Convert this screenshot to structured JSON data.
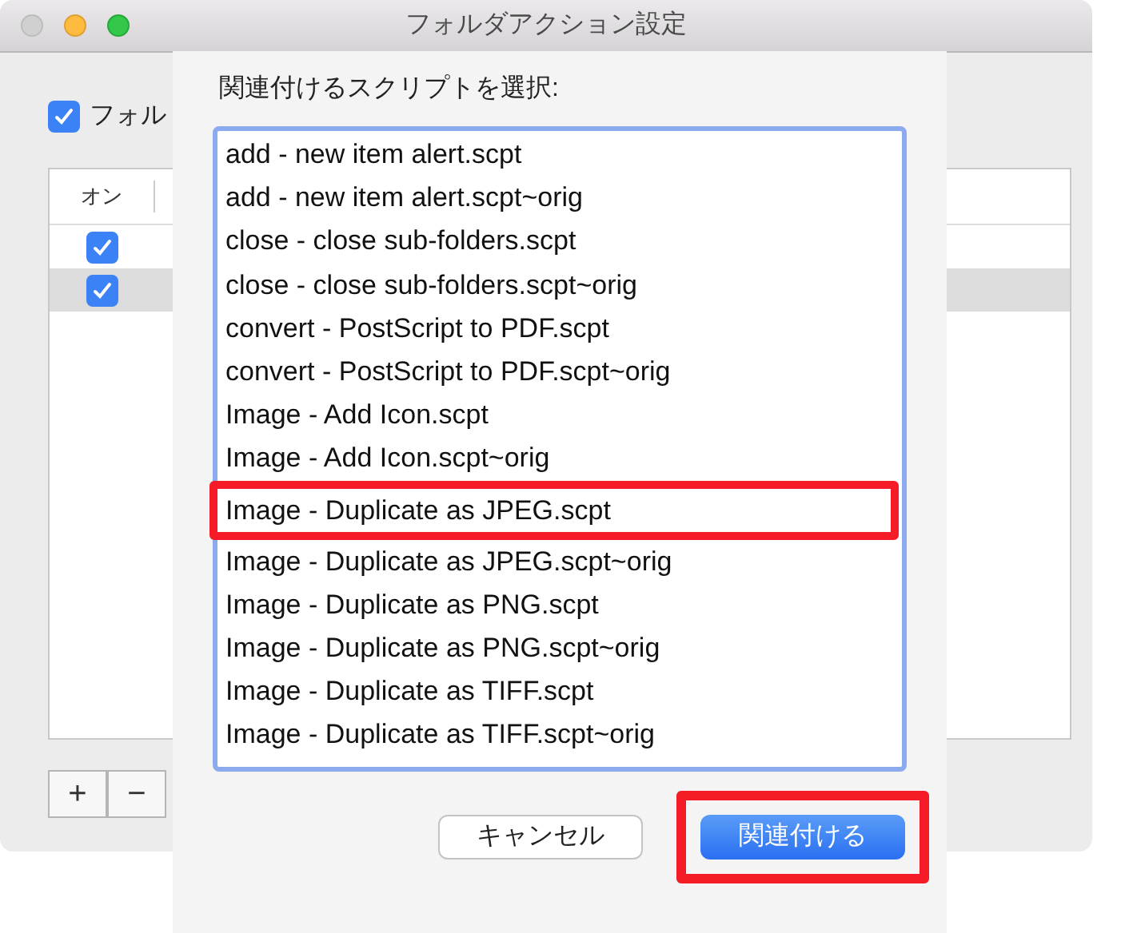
{
  "window": {
    "title": "フォルダアクション設定"
  },
  "background": {
    "enable_checkbox": {
      "label": "フォル",
      "checked": true
    },
    "table": {
      "columns": [
        "オン"
      ],
      "rows": [
        {
          "on": true,
          "selected": false
        },
        {
          "on": true,
          "selected": true
        }
      ]
    },
    "buttons": [
      "+",
      "−"
    ]
  },
  "sheet": {
    "prompt": "関連付けるスクリプトを選択:",
    "scripts": [
      {
        "name": "add - new item alert.scpt",
        "highlighted": false
      },
      {
        "name": "add - new item alert.scpt~orig",
        "highlighted": false
      },
      {
        "name": "close - close sub-folders.scpt",
        "highlighted": false
      },
      {
        "name": "close - close sub-folders.scpt~orig",
        "highlighted": false
      },
      {
        "name": "convert - PostScript to PDF.scpt",
        "highlighted": false
      },
      {
        "name": "convert - PostScript to PDF.scpt~orig",
        "highlighted": false
      },
      {
        "name": "Image - Add Icon.scpt",
        "highlighted": false
      },
      {
        "name": "Image - Add Icon.scpt~orig",
        "highlighted": false
      },
      {
        "name": "Image - Duplicate as JPEG.scpt",
        "highlighted": true
      },
      {
        "name": "Image - Duplicate as JPEG.scpt~orig",
        "highlighted": false
      },
      {
        "name": "Image - Duplicate as PNG.scpt",
        "highlighted": false
      },
      {
        "name": "Image - Duplicate as PNG.scpt~orig",
        "highlighted": false
      },
      {
        "name": "Image - Duplicate as TIFF.scpt",
        "highlighted": false
      },
      {
        "name": "Image - Duplicate as TIFF.scpt~orig",
        "highlighted": false
      }
    ],
    "buttons": [
      {
        "label": "キャンセル",
        "kind": "default",
        "highlighted": false
      },
      {
        "label": "関連付ける",
        "kind": "primary",
        "highlighted": true
      }
    ]
  }
}
